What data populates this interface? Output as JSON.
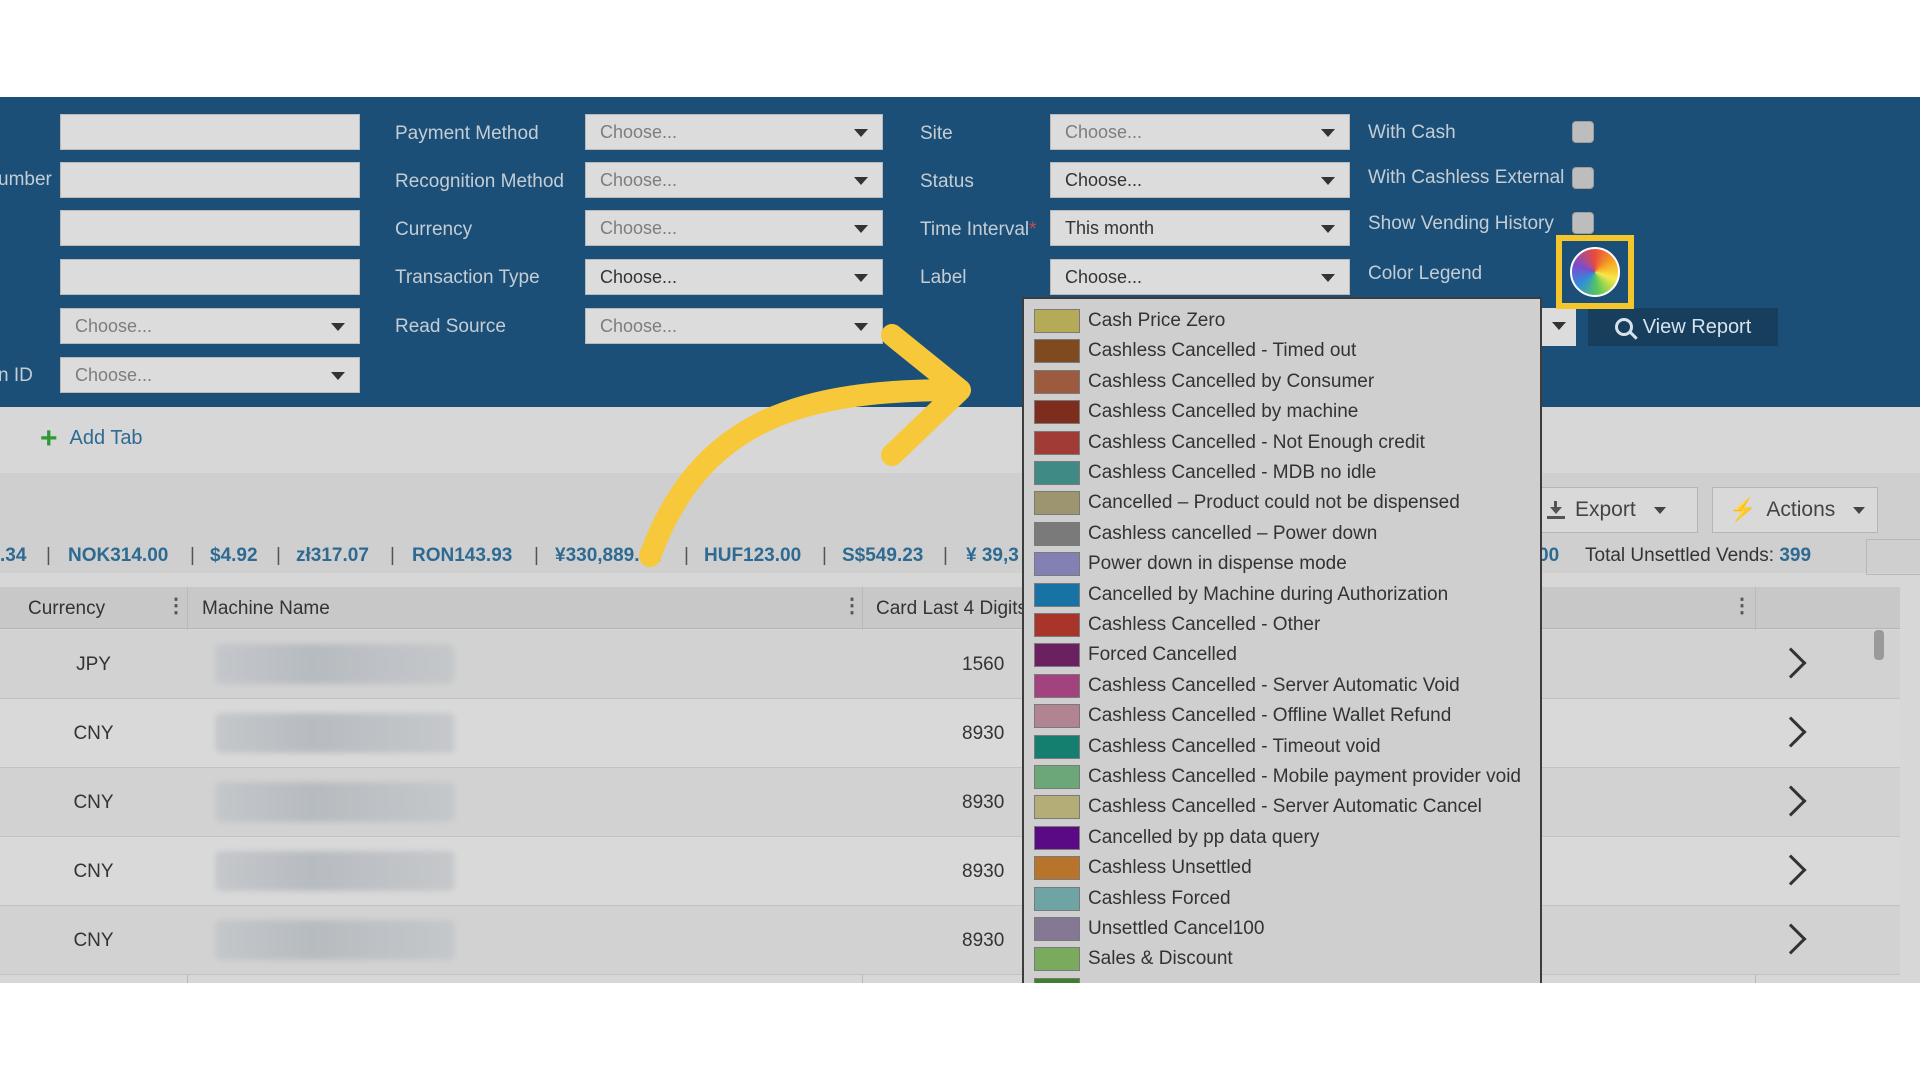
{
  "filters": {
    "left_labels": [
      "umber",
      "n ID"
    ],
    "left_select_placeholder": "Choose...",
    "col2": [
      {
        "label": "Payment Method",
        "value": "Choose..."
      },
      {
        "label": "Recognition Method",
        "value": "Choose..."
      },
      {
        "label": "Currency",
        "value": "Choose..."
      },
      {
        "label": "Transaction Type",
        "value": "Choose..."
      },
      {
        "label": "Read Source",
        "value": "Choose..."
      }
    ],
    "col3": [
      {
        "label": "Site",
        "value": "Choose..."
      },
      {
        "label": "Status",
        "value": "Choose..."
      },
      {
        "label": "Time Interval",
        "value": "This month",
        "required_mark": "*"
      },
      {
        "label": "Label",
        "value": "Choose..."
      }
    ],
    "checks": [
      {
        "label": "With Cash"
      },
      {
        "label": "With Cashless External"
      },
      {
        "label": "Show Vending History"
      }
    ],
    "color_legend_label": "Color Legend",
    "view_report_label": "View Report"
  },
  "tabs": {
    "add_tab_label": "Add Tab",
    "edge_fragment": ":"
  },
  "toolbar": {
    "export_label": "Export",
    "actions_label": "Actions"
  },
  "totals": {
    "items": [
      ".34",
      "NOK314.00",
      "$4.92",
      "zł317.07",
      "RON143.93",
      "¥330,889.41",
      "HUF123.00",
      "S$549.23",
      "¥ 39,3",
      "00"
    ],
    "unsettled_label": "Total Unsettled Vends:",
    "unsettled_value": "399"
  },
  "table": {
    "headers": {
      "currency": "Currency",
      "machine_name": "Machine Name",
      "card_last4": "Card Last 4 Digits"
    },
    "rows": [
      {
        "currency": "JPY",
        "card": "1560"
      },
      {
        "currency": "CNY",
        "card": "8930"
      },
      {
        "currency": "CNY",
        "card": "8930"
      },
      {
        "currency": "CNY",
        "card": "8930"
      },
      {
        "currency": "CNY",
        "card": "8930"
      }
    ]
  },
  "legend": {
    "items": [
      {
        "label": "Cash Price Zero",
        "color": "#b5aa57"
      },
      {
        "label": "Cashless Cancelled - Timed out",
        "color": "#7f4a1f"
      },
      {
        "label": "Cashless Cancelled by Consumer",
        "color": "#9c5a3f"
      },
      {
        "label": "Cashless Cancelled by machine",
        "color": "#7e2c1e"
      },
      {
        "label": "Cashless Cancelled - Not Enough credit",
        "color": "#a03b35"
      },
      {
        "label": "Cashless Cancelled - MDB no idle",
        "color": "#3f8a84"
      },
      {
        "label": "Cancelled – Product could not be dispensed",
        "color": "#9d9570"
      },
      {
        "label": "Cashless cancelled – Power down",
        "color": "#7a7a7a"
      },
      {
        "label": "Power down in dispense mode",
        "color": "#8380b4"
      },
      {
        "label": "Cancelled by Machine during Authorization",
        "color": "#1673a4"
      },
      {
        "label": "Cashless Cancelled - Other",
        "color": "#a9352a"
      },
      {
        "label": "Forced Cancelled",
        "color": "#6b2060"
      },
      {
        "label": "Cashless Cancelled - Server Automatic Void",
        "color": "#a2427f"
      },
      {
        "label": "Cashless Cancelled - Offline Wallet Refund",
        "color": "#b08490"
      },
      {
        "label": "Cashless Cancelled - Timeout void",
        "color": "#157f6f"
      },
      {
        "label": "Cashless Cancelled - Mobile payment provider void",
        "color": "#6ca777"
      },
      {
        "label": "Cashless Cancelled - Server Automatic Cancel",
        "color": "#b4ad78"
      },
      {
        "label": "Cancelled by pp data query",
        "color": "#5b0a86"
      },
      {
        "label": "Cashless Unsettled",
        "color": "#b8742a"
      },
      {
        "label": "Cashless Forced",
        "color": "#6fa4a4"
      },
      {
        "label": "Unsettled Cancel100",
        "color": "#847895"
      },
      {
        "label": "Sales & Discount",
        "color": "#79aa5e"
      },
      {
        "label": "",
        "color": "#3f7e2c"
      }
    ]
  },
  "colors": {
    "panel": "#1b4f78",
    "highlight": "#f4c62c",
    "arrow": "#f7c83a"
  }
}
